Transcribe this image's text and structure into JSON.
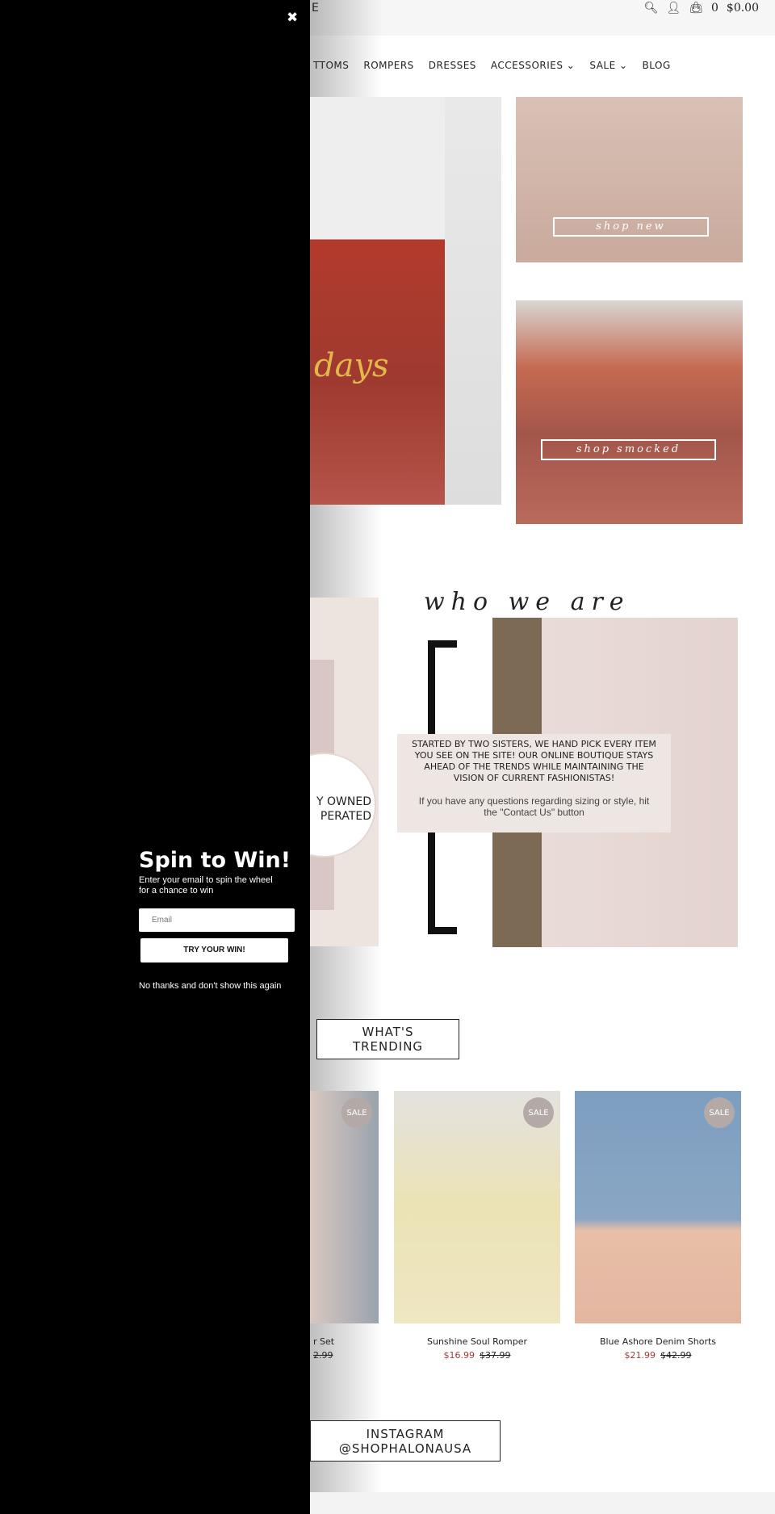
{
  "header": {
    "brand_partial": "E",
    "cart_count": "0",
    "cart_total": "$0.00",
    "icons": [
      "search-icon",
      "user-icon",
      "shopping-bag-icon"
    ]
  },
  "nav": {
    "items": [
      {
        "label": "TTOMS"
      },
      {
        "label": "ROMPERS"
      },
      {
        "label": "DRESSES"
      },
      {
        "label": "ACCESSORIES ⌄"
      },
      {
        "label": "SALE ⌄"
      },
      {
        "label": "BLOG"
      }
    ]
  },
  "hero": {
    "script_text": "days",
    "shop_new": "shop new",
    "shop_smocked": "shop smocked"
  },
  "about": {
    "heading": "who we are",
    "circle_text_1": "Y OWNED",
    "circle_text_2": "PERATED",
    "body": "STARTED BY TWO SISTERS, WE HAND PICK EVERY ITEM YOU SEE ON THE SITE! OUR ONLINE BOUTIQUE STAYS AHEAD OF THE TRENDS WHILE MAINTAINING THE VISION OF CURRENT FASHIONISTAS!",
    "contact_note": "If you have any questions regarding sizing or style, hit the \"Contact Us\" button"
  },
  "trending": {
    "title_1": "WHAT'S",
    "title_2": "TRENDING",
    "products": [
      {
        "name": "r Set",
        "price": "",
        "was": "2.99",
        "badge": "SALE"
      },
      {
        "name": "Sunshine Soul Romper",
        "price": "$16.99",
        "was": "$37.99",
        "badge": "SALE"
      },
      {
        "name": "Blue Ashore Denim Shorts",
        "price": "$21.99",
        "was": "$42.99",
        "badge": "SALE"
      }
    ]
  },
  "instagram": {
    "line1": "INSTAGRAM",
    "line2": "@SHOPHALONAUSA"
  },
  "popup": {
    "close": "✖",
    "title": "Spin to Win!",
    "subtitle": "Enter your email to spin the wheel for a chance to win",
    "email_placeholder": "Email",
    "submit": "TRY YOUR WIN!",
    "dismiss": "No thanks and don't show this again"
  },
  "colors": {
    "sale_price": "#9b3a3a",
    "popup_bg": "#000000",
    "topbar_bg": "#f6f6f6"
  }
}
